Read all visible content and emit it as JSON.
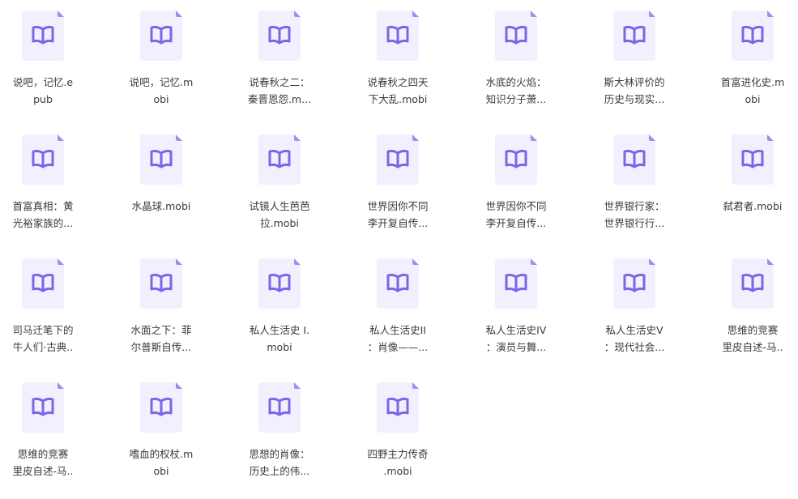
{
  "files": [
    {
      "name": "说吧，记忆.epub",
      "lines": [
        "说吧，记忆.e",
        "pub"
      ]
    },
    {
      "name": "说吧，记忆.mobi",
      "lines": [
        "说吧，记忆.m",
        "obi"
      ]
    },
    {
      "name": "说春秋之二：秦晋恩怨.mobi",
      "lines": [
        "说春秋之二：",
        "秦晋恩怨.m..."
      ]
    },
    {
      "name": "说春秋之四天下大乱.mobi",
      "lines": [
        "说春秋之四天",
        "下大乱.mobi"
      ]
    },
    {
      "name": "水底的火焰：知识分子萧...",
      "lines": [
        "水底的火焰：",
        "知识分子萧..."
      ]
    },
    {
      "name": "斯大林评价的历史与现实...",
      "lines": [
        "斯大林评价的",
        "历史与现实..."
      ]
    },
    {
      "name": "首富进化史.mobi",
      "lines": [
        "首富进化史.m",
        "obi"
      ]
    },
    {
      "name": "首富真相：黄光裕家族的...",
      "lines": [
        "首富真相：黄",
        "光裕家族的..."
      ]
    },
    {
      "name": "水晶球.mobi",
      "lines": [
        "水晶球.mobi"
      ]
    },
    {
      "name": "试镜人生芭芭拉.mobi",
      "lines": [
        "试镜人生芭芭",
        "拉.mobi"
      ]
    },
    {
      "name": "世界因你不同李开复自传...",
      "lines": [
        "世界因你不同",
        "李开复自传..."
      ]
    },
    {
      "name": "世界因你不同李开复自传...",
      "lines": [
        "世界因你不同",
        "李开复自传..."
      ]
    },
    {
      "name": "世界银行家：世界银行行...",
      "lines": [
        "世界银行家：",
        "世界银行行..."
      ]
    },
    {
      "name": "弑君者.mobi",
      "lines": [
        "弑君者.mobi"
      ]
    },
    {
      "name": "司马迁笔下的牛人们·古典...",
      "lines": [
        "司马迁笔下的",
        "牛人们·古典.."
      ]
    },
    {
      "name": "水面之下：菲尔普斯自传...",
      "lines": [
        "水面之下：菲",
        "尔普斯自传..."
      ]
    },
    {
      "name": "私人生活史 I.mobi",
      "lines": [
        "私人生活史 I.",
        "mobi"
      ]
    },
    {
      "name": "私人生活史II：肖像——...",
      "lines": [
        "私人生活史II",
        "：肖像——..."
      ]
    },
    {
      "name": "私人生活史IV：演员与舞...",
      "lines": [
        "私人生活史IV",
        "：演员与舞..."
      ]
    },
    {
      "name": "私人生活史V：现代社会...",
      "lines": [
        "私人生活史V",
        "：现代社会..."
      ]
    },
    {
      "name": "思维的竞赛里皮自述-马...",
      "lines": [
        "思维的竞赛",
        "里皮自述-马.."
      ]
    },
    {
      "name": "思维的竞赛里皮自述-马...",
      "lines": [
        "思维的竞赛",
        "里皮自述-马.."
      ]
    },
    {
      "name": "嗜血的权杖.mobi",
      "lines": [
        "嗜血的权杖.m",
        "obi"
      ]
    },
    {
      "name": "思想的肖像：历史上的伟...",
      "lines": [
        "思想的肖像：",
        "历史上的伟..."
      ]
    },
    {
      "name": "四野主力传奇.mobi",
      "lines": [
        "四野主力传奇",
        ".mobi"
      ]
    }
  ],
  "icon_colors": {
    "page": "#f1f0ff",
    "fold": "#9b8ff0",
    "book": "#7a66e6"
  }
}
